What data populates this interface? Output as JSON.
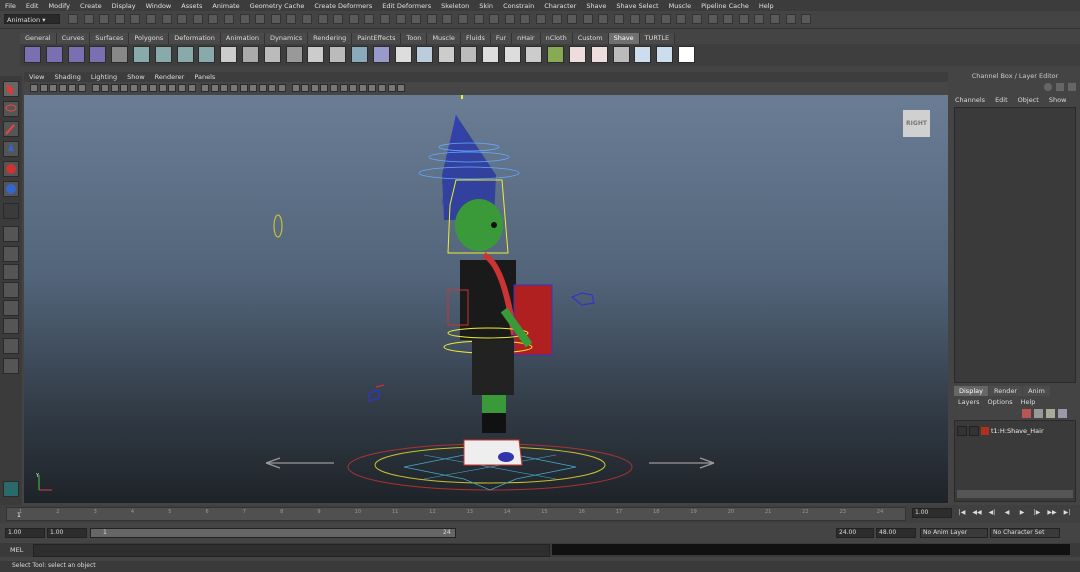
{
  "menubar": [
    "File",
    "Edit",
    "Modify",
    "Create",
    "Display",
    "Window",
    "Assets",
    "Animate",
    "Geometry Cache",
    "Create Deformers",
    "Edit Deformers",
    "Skeleton",
    "Skin",
    "Constrain",
    "Character",
    "Shave",
    "Shave Select",
    "Muscle",
    "Pipeline Cache",
    "Help"
  ],
  "status_line": {
    "mode": "Animation"
  },
  "shelf_tabs": [
    "General",
    "Curves",
    "Surfaces",
    "Polygons",
    "Deformation",
    "Animation",
    "Dynamics",
    "Rendering",
    "PaintEffects",
    "Toon",
    "Muscle",
    "Fluids",
    "Fur",
    "nHair",
    "nCloth",
    "Custom",
    "Shave",
    "TURTLE"
  ],
  "active_shelf_tab": "Shave",
  "viewport": {
    "menus": [
      "View",
      "Shading",
      "Lighting",
      "Show",
      "Renderer",
      "Panels"
    ],
    "view_cube_label": "RIGHT",
    "axis_label": "Y"
  },
  "channel_box": {
    "title": "Channel Box / Layer Editor",
    "menus": [
      "Channels",
      "Edit",
      "Object",
      "Show"
    ]
  },
  "layer_editor": {
    "tabs": [
      "Display",
      "Render",
      "Anim"
    ],
    "active_tab": "Display",
    "menus": [
      "Layers",
      "Options",
      "Help"
    ],
    "layers": [
      {
        "name": "t1:H:Shave_Hair",
        "color": "#b0301e"
      }
    ]
  },
  "time_slider": {
    "ticks": [
      "1",
      "2",
      "3",
      "4",
      "5",
      "6",
      "7",
      "8",
      "9",
      "10",
      "11",
      "12",
      "13",
      "14",
      "15",
      "16",
      "17",
      "18",
      "19",
      "20",
      "21",
      "22",
      "23",
      "24"
    ],
    "current_frame": "1",
    "current_field": "1.00"
  },
  "range_slider": {
    "start_time": "1.00",
    "playback_start": "1.00",
    "slider_start": "1",
    "slider_end": "24",
    "playback_end": "24.00",
    "end_time": "48.00",
    "anim_layer": "No Anim Layer",
    "character_set": "No Character Set"
  },
  "command_line": {
    "label": "MEL"
  },
  "help_line": {
    "text": "Select Tool: select an object"
  },
  "colors": {
    "viewport_top": "#6a7d94",
    "viewport_bottom": "#1e2328",
    "active_tab": "#707070"
  }
}
